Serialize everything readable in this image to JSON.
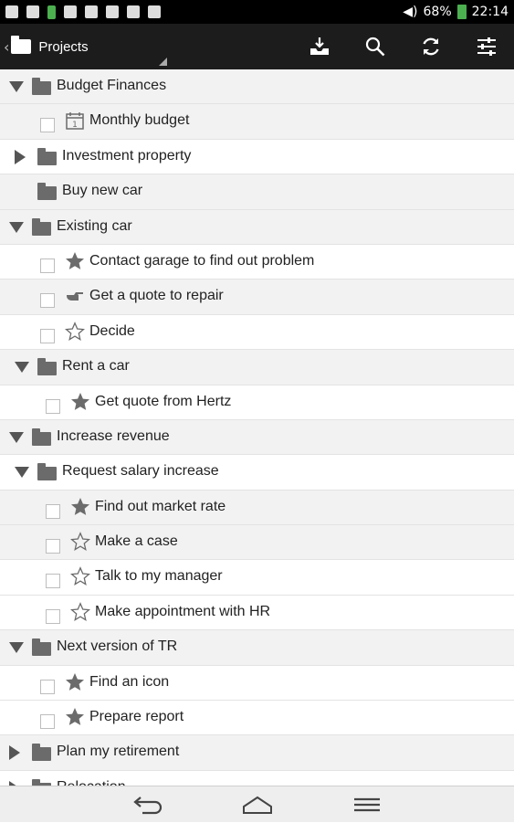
{
  "status_bar": {
    "battery": "68%",
    "time": "22:14"
  },
  "action_bar": {
    "title": "Projects"
  },
  "rows": [
    {
      "label": "Budget Finances",
      "level": 0,
      "kind": "folder",
      "expand": "down"
    },
    {
      "label": "Monthly budget",
      "level": 1,
      "kind": "task",
      "icon": "calendar"
    },
    {
      "label": "Investment property",
      "level": 1,
      "kind": "folder",
      "expand": "right"
    },
    {
      "label": "Buy new car",
      "level": 1,
      "kind": "folder",
      "expand": "none"
    },
    {
      "label": "Existing car",
      "level": 0,
      "kind": "folder",
      "expand": "down"
    },
    {
      "label": "Contact garage to find out problem",
      "level": 1,
      "kind": "task",
      "icon": "star-filled"
    },
    {
      "label": "Get a quote to repair",
      "level": 1,
      "kind": "task",
      "icon": "pointing-hand"
    },
    {
      "label": "Decide",
      "level": 1,
      "kind": "task",
      "icon": "star-outline"
    },
    {
      "label": "Rent a car",
      "level": 1,
      "kind": "folder",
      "expand": "down"
    },
    {
      "label": "Get quote from Hertz",
      "level": 2,
      "kind": "task",
      "icon": "star-filled"
    },
    {
      "label": "Increase revenue",
      "level": 0,
      "kind": "folder",
      "expand": "down"
    },
    {
      "label": "Request salary increase",
      "level": 1,
      "kind": "folder",
      "expand": "down"
    },
    {
      "label": "Find out market rate",
      "level": 2,
      "kind": "task",
      "icon": "star-filled"
    },
    {
      "label": "Make a case",
      "level": 2,
      "kind": "task",
      "icon": "star-outline"
    },
    {
      "label": "Talk to my manager",
      "level": 2,
      "kind": "task",
      "icon": "star-outline"
    },
    {
      "label": "Make appointment with HR",
      "level": 2,
      "kind": "task",
      "icon": "star-outline"
    },
    {
      "label": "Next version of TR",
      "level": 0,
      "kind": "folder",
      "expand": "down"
    },
    {
      "label": "Find an icon",
      "level": 1,
      "kind": "task",
      "icon": "star-filled"
    },
    {
      "label": "Prepare report",
      "level": 1,
      "kind": "task",
      "icon": "star-filled"
    },
    {
      "label": "Plan my retirement",
      "level": 0,
      "kind": "folder",
      "expand": "right"
    },
    {
      "label": "Relocation",
      "level": 0,
      "kind": "folder",
      "expand": "right"
    }
  ],
  "colors": {
    "action_bar": "#1c1c1c",
    "status_bar": "#000000",
    "icon_gray": "#6b6b6b",
    "battery_green": "#4caf50"
  }
}
